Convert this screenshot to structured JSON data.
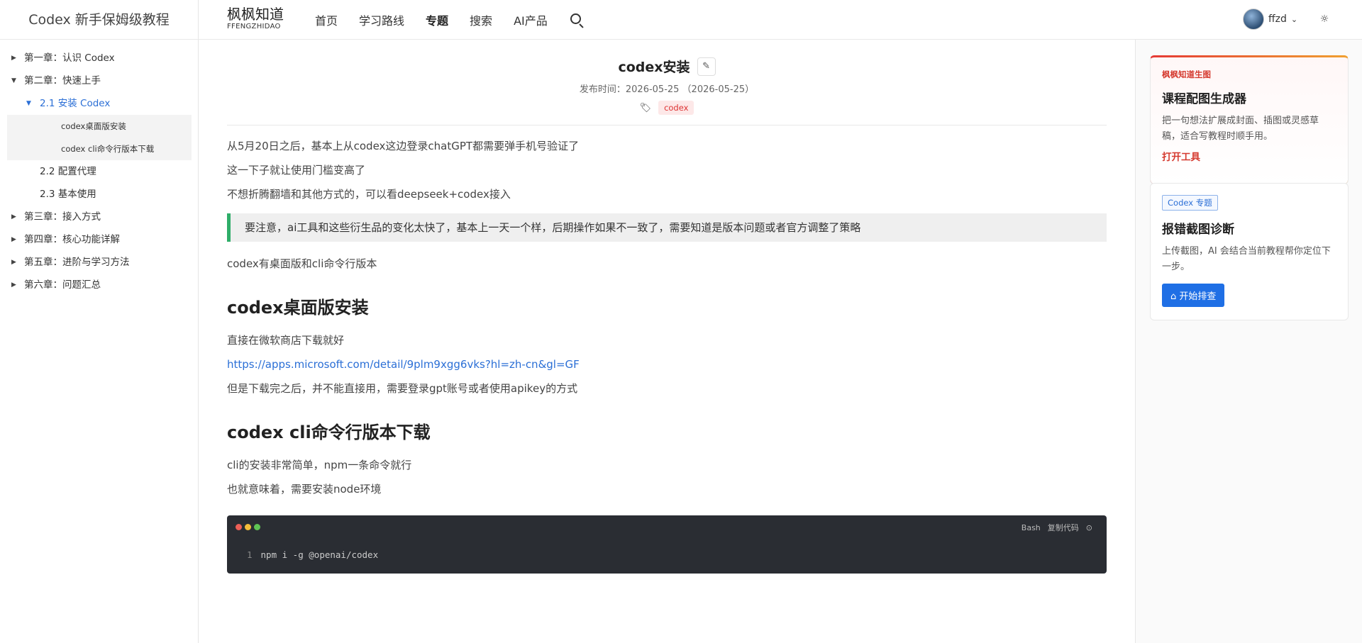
{
  "sidebar": {
    "site_title": "Codex 新手保姆级教程",
    "toc": {
      "ch1": "第一章：认识 Codex",
      "ch2": "第二章：快速上手",
      "sec21": "2.1 安装 Codex",
      "leaf1": "codex桌面版安装",
      "leaf2": "codex cli命令行版本下载",
      "sec22": "2.2 配置代理",
      "sec23": "2.3 基本使用",
      "ch3": "第三章：接入方式",
      "ch4": "第四章：核心功能详解",
      "ch5": "第五章：进阶与学习方法",
      "ch6": "第六章：问题汇总"
    }
  },
  "topnav": {
    "brand_name": "枫枫知道",
    "brand_sub": "FFENGZHIDAO",
    "links": [
      "首页",
      "学习路线",
      "专题",
      "搜索",
      "AI产品"
    ],
    "user_name": "ffzd",
    "icons": [
      "search-icon",
      "chevron-down-icon",
      "sun-icon"
    ]
  },
  "article": {
    "title": "codex安装",
    "meta": "发布时间：2026-05-25 （2026-05-25）",
    "tag": "codex",
    "p1": "从5月20日之后，基本上从codex这边登录chatGPT都需要弹手机号验证了",
    "p2": "这一下子就让使用门槛变高了",
    "p3": "不想折腾翻墙和其他方式的，可以看deepseek+codex接入",
    "callout": "要注意，ai工具和这些衍生品的变化太快了，基本上一天一个样，后期操作如果不一致了，需要知道是版本问题或者官方调整了策略",
    "p4": "codex有桌面版和cli命令行版本",
    "h2_desktop": "codex桌面版安装",
    "p5": "直接在微软商店下载就好",
    "link": "https://apps.microsoft.com/detail/9plm9xgg6vks?hl=zh-cn&gl=GF",
    "p6": "但是下载完之后，并不能直接用，需要登录gpt账号或者使用apikey的方式",
    "h2_cli": "codex cli命令行版本下载",
    "p7": "cli的安装非常简单，npm一条命令就行",
    "p8": "也就意味着，需要安装node环境",
    "code": {
      "lang": "Bash",
      "copy": "复制代码",
      "line_no": "1",
      "line": "npm i -g @openai/codex"
    }
  },
  "rightbar": {
    "card1": {
      "kicker": "枫枫知道生图",
      "title": "课程配图生成器",
      "desc": "把一句想法扩展成封面、插图或灵感草稿，适合写教程时顺手用。",
      "link": "打开工具"
    },
    "card2": {
      "badge": "Codex 专题",
      "title": "报错截图诊断",
      "desc": "上传截图，AI 会结合当前教程帮你定位下一步。",
      "button": "开始排查"
    }
  },
  "colors": {
    "accent_blue": "#2b6fd6",
    "callout_green": "#2fae69",
    "brand_red": "#d53a2f",
    "code_bg": "#2a2d33"
  }
}
